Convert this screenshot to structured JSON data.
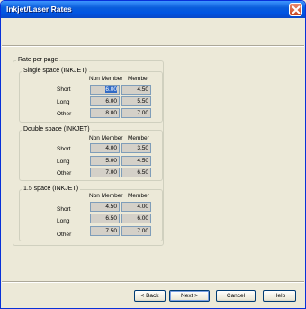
{
  "window": {
    "title": "Inkjet/Laser Rates"
  },
  "rates": {
    "title": "Rate per page",
    "columns": {
      "non_member": "Non Member",
      "member": "Member"
    },
    "groups": [
      {
        "title": "Single space (INKJET)",
        "rows": [
          {
            "label": "Short",
            "non_member": "6.00",
            "member": "4.50"
          },
          {
            "label": "Long",
            "non_member": "6.00",
            "member": "5.50"
          },
          {
            "label": "Other",
            "non_member": "8.00",
            "member": "7.00"
          }
        ]
      },
      {
        "title": "Double space (INKJET)",
        "rows": [
          {
            "label": "Short",
            "non_member": "4.00",
            "member": "3.50"
          },
          {
            "label": "Long",
            "non_member": "5.00",
            "member": "4.50"
          },
          {
            "label": "Other",
            "non_member": "7.00",
            "member": "6.50"
          }
        ]
      },
      {
        "title": "1.5 space (INKJET)",
        "rows": [
          {
            "label": "Short",
            "non_member": "4.50",
            "member": "4.00"
          },
          {
            "label": "Long",
            "non_member": "6.50",
            "member": "6.00"
          },
          {
            "label": "Other",
            "non_member": "7.50",
            "member": "7.00"
          }
        ]
      }
    ]
  },
  "buttons": {
    "back": "< Back",
    "next": "Next >",
    "cancel": "Cancel",
    "help": "Help"
  },
  "colors": {
    "titlebar": "#0054e3",
    "selection": "#316ac5"
  }
}
